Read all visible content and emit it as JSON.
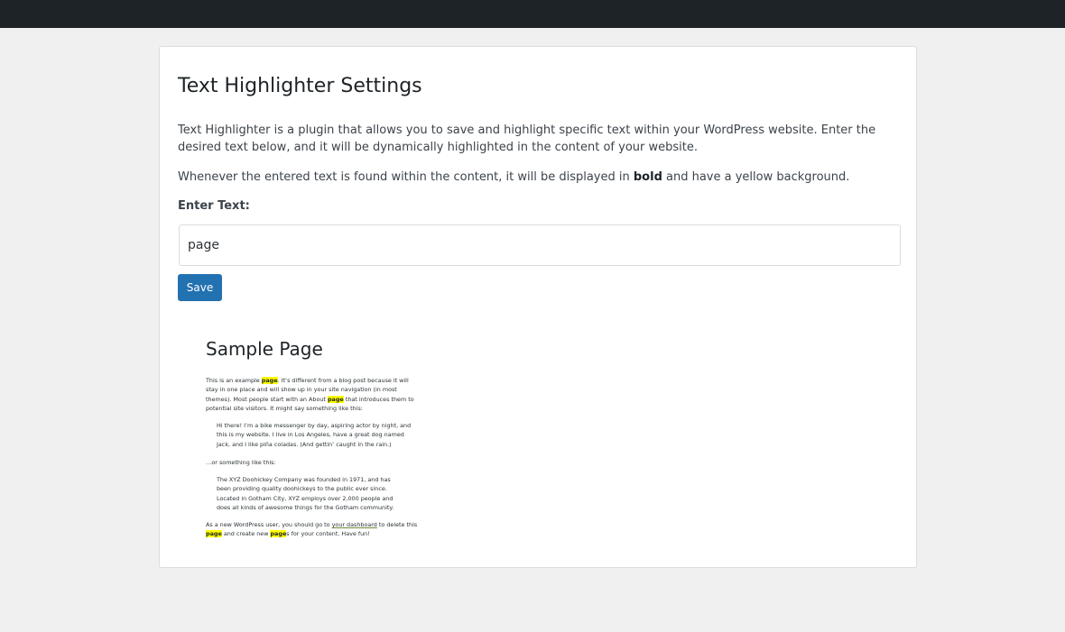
{
  "settings": {
    "title": "Text Highlighter Settings",
    "description": "Text Highlighter is a plugin that allows you to save and highlight specific text within your WordPress website. Enter the desired text below, and it will be dynamically highlighted in the content of your website.",
    "note_before": "Whenever the entered text is found within the content, it will be displayed in",
    "note_bold": "bold",
    "note_after": "and have a yellow background.",
    "input_label": "Enter Text:",
    "input_value": "page",
    "save_label": "Save"
  },
  "preview": {
    "title": "Sample Page",
    "p1": {
      "a": "This is an example",
      "hl1": "page",
      "b": ". It’s different from a blog post because it will stay in one place and will show up in your site navigation (in most themes). Most people start with an About",
      "hl2": "page",
      "c": "that introduces them to potential site visitors. It might say something like this:"
    },
    "quote1": "Hi there! I’m a bike messenger by day, aspiring actor by night, and this is my website. I live in Los Angeles, have a great dog named Jack, and I like piña coladas. (And gettin’ caught in the rain.)",
    "p2": "…or something like this:",
    "quote2": "The XYZ Doohickey Company was founded in 1971, and has been providing quality doohickeys to the public ever since. Located in Gotham City, XYZ employs over 2,000 people and does all kinds of awesome things for the Gotham community.",
    "p3": {
      "a": "As a new WordPress user, you should go to",
      "link": "your dashboard",
      "b": "to delete this",
      "hl1": "page",
      "c": "and create new",
      "hl2": "page",
      "d": "s for your content. Have fun!"
    }
  },
  "colors": {
    "admin_bar": "#1d2327",
    "background": "#f0f0f1",
    "button": "#2271b1",
    "highlight": "#ffff00"
  }
}
